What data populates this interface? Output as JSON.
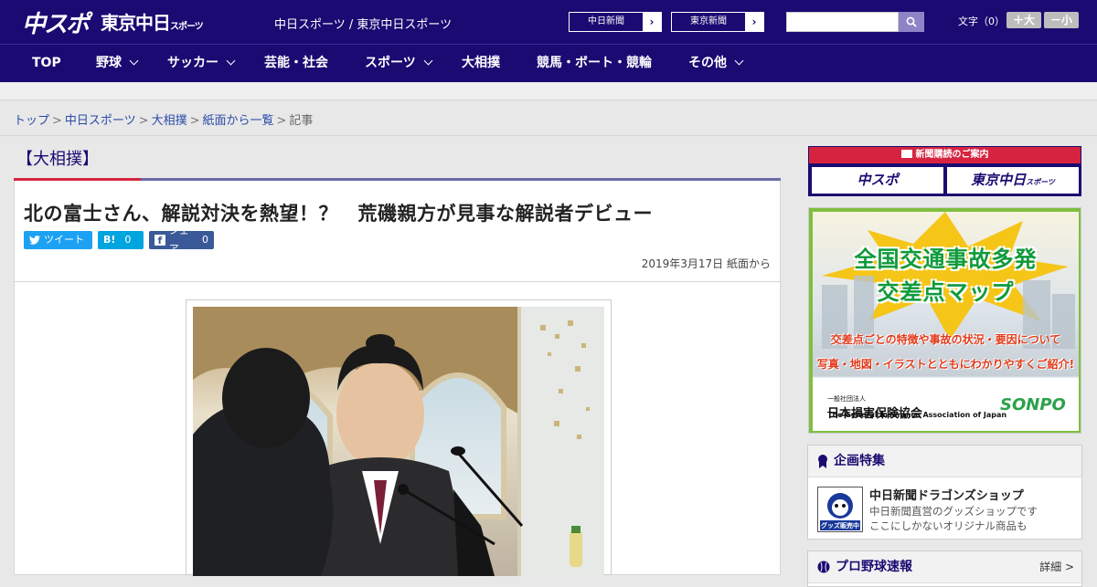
{
  "header": {
    "logo_main": "中スポ",
    "logo_sub": "東京中日",
    "logo_sub_small": "スポーツ",
    "tagline": "中日スポーツ / 東京中日スポーツ",
    "ext_links": [
      "中日新聞",
      "東京新聞"
    ],
    "search_placeholder": "",
    "font_size_label": "文字（0）",
    "font_larger": "＋大",
    "font_smaller": "－小"
  },
  "nav": {
    "items": [
      {
        "label": "TOP"
      },
      {
        "label": "野球"
      },
      {
        "label": "サッカー"
      },
      {
        "label": "芸能・社会"
      },
      {
        "label": "スポーツ"
      },
      {
        "label": "大相撲"
      },
      {
        "label": "競馬・ボート・競輪"
      },
      {
        "label": "その他"
      }
    ]
  },
  "breadcrumb": {
    "items": [
      "トップ",
      "中日スポーツ",
      "大相撲",
      "紙面から一覧"
    ],
    "current": "記事",
    "separator": ">"
  },
  "article": {
    "category": "【大相撲】",
    "headline": "北の富士さん、解説対決を熱望！？　荒磯親方が見事な解説者デビュー",
    "share": {
      "tweet": "ツイート",
      "hatena_icon": "B!",
      "hatena_count": "0",
      "facebook_icon": "f",
      "facebook_label": "シェア",
      "facebook_count": "0"
    },
    "date": "2019年3月17日 紙面から"
  },
  "sidebar": {
    "subscription": {
      "title": "新聞購読のご案内",
      "button_chunichi_sports": "中スポ",
      "button_tokyo": "東京中日",
      "button_tokyo_small": "スポーツ"
    },
    "ad": {
      "title_line1": "全国交通事故多発",
      "title_line2": "交差点マップ",
      "desc_line1": "交差点ごとの特徴や事故の状況・要因について",
      "desc_line2": "写真・地図・イラストとともにわかりやすくご紹介!",
      "org_small": "一般社団法人",
      "org": "日本損害保険協会",
      "org_en": "The General Insurance Association of Japan",
      "logo": "SONPO"
    },
    "feature": {
      "heading": "企画特集",
      "item_title": "中日新聞ドラゴンズショップ",
      "item_desc_1": "中日新聞直営のグッズショップです",
      "item_desc_2": "ここにしかないオリジナル商品も",
      "thumb_badge": "グッズ販売中"
    },
    "baseball": {
      "heading": "プロ野球速報",
      "detail": "詳細 >"
    }
  },
  "colors": {
    "brand_navy": "#1b0a72",
    "accent_red": "#d62440",
    "twitter": "#1da1f2",
    "hatena": "#00a4de",
    "facebook": "#3b5998"
  }
}
